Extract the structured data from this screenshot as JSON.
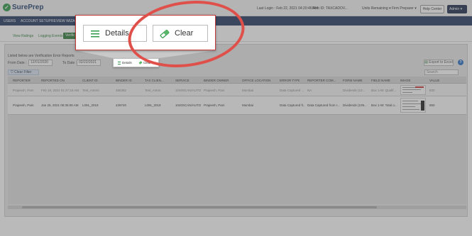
{
  "header": {
    "logo_text": "SurePrep",
    "last_login": "Last Login : Feb 22, 2021 04:20:46 AM",
    "firm_id": "Firm ID:  TAXCADOV...",
    "units_remaining": "Units Remaining",
    "role": "Firm Preparer",
    "help_center": "Help Center",
    "admin": "Admin"
  },
  "nav": {
    "items": [
      "USERS",
      "ACCOUNT SETUP",
      "REVIEW WIZARD"
    ]
  },
  "subnav": {
    "items": [
      "View Ratings",
      "Logging Events"
    ],
    "active": "Verific"
  },
  "page": {
    "info_line": "Listed below are Verification Error Reports",
    "from_date_label": "From Date :",
    "from_date_value": "12/01/2020",
    "to_date_label": "To Date :",
    "to_date_value": "02/22/2021",
    "export_label": "Export to Excel",
    "help_glyph": "?",
    "clear_filter": "Clear Filter",
    "search_placeholder": "Search"
  },
  "table": {
    "headers": [
      "REPORTER",
      "REPORTED ON",
      "CLIENT ID",
      "BINDER ID",
      "TAX CLIEN...",
      "SERVICE",
      "BINDER OWNER",
      "OFFICE LOCATION",
      "ERROR TYPE",
      "REPORTER COM...",
      "FORM NAME",
      "FIELD NAME",
      "IMAGE",
      "VALUE"
    ],
    "filters": [
      "Prajeesh, Pam",
      "Feb 19, 2021 01:37:18 AM",
      "Test_Antoni",
      "455382",
      "Test_Anton",
      "1040SCAN/AUTO",
      "Prajeesh, Pam",
      "Mumbai",
      "Data Captured ...",
      "NA",
      "Dividends (10...",
      "Box 1-W: Qualif...",
      "",
      "830"
    ],
    "row": [
      "Prajeesh, Pam",
      "Jan 25, 2021 05:36:06 AM",
      "L091_2019",
      "429740",
      "L091_2019",
      "1040SCAN/AUTO",
      "Prajeesh, Pam",
      "Mumbai",
      "Data Captured fr...",
      "Data Captured from I...",
      "Dividends (109...",
      "Box 1-W: Total o...",
      "",
      "850"
    ]
  },
  "mini_popup": {
    "details": "Details",
    "clear": "Clear"
  },
  "zoom": {
    "details": "Details",
    "clear": "Clear"
  },
  "colors": {
    "brand_green": "#2e9a48",
    "nav_navy": "#243a62",
    "highlight_red": "#e0504a"
  }
}
